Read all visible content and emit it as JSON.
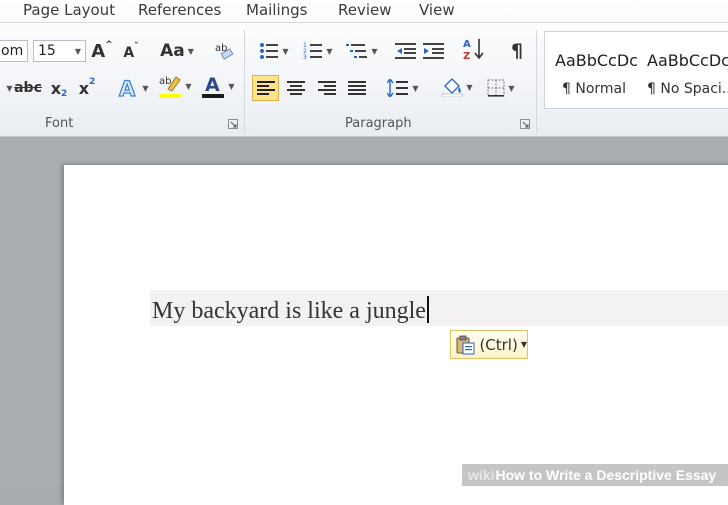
{
  "tabs": [
    "Page Layout",
    "References",
    "Mailings",
    "Review",
    "View"
  ],
  "font": {
    "name_partial": "om",
    "size": "15",
    "group_label": "Font",
    "highlight_color": "#ffff00",
    "font_color": "#1a1a1a",
    "highlight_letters": "ab",
    "change_case_label": "Aa",
    "spell_letters": "ab",
    "grow_letter": "A",
    "shrink_letter": "A",
    "sub_letter": "x",
    "sup_letter": "x",
    "sub_index": "2",
    "sup_index": "2",
    "strike_letters": "abc",
    "effects_letter": "A",
    "color_letter": "A"
  },
  "paragraph": {
    "group_label": "Paragraph",
    "pilcrow": "¶",
    "sort_a": "A",
    "sort_z": "Z"
  },
  "styles": [
    {
      "sample": "AaBbCcDc",
      "name": "¶ Normal"
    },
    {
      "sample": "AaBbCcDc",
      "name": "¶ No Spaci..."
    }
  ],
  "document": {
    "text": "My backyard is like a jungle"
  },
  "paste_options": {
    "label": "(Ctrl)"
  },
  "watermark": {
    "brand": "wiki",
    "title": "How to Write a Descriptive Essay"
  },
  "colors": {
    "accent_selected": "#fde38a",
    "ribbon_bg": "#f3f5f8",
    "page_bg": "#ffffff",
    "workspace_bg": "#a9acb1"
  },
  "icons": {
    "launcher": "dialog-launcher-icon",
    "paste": "clipboard-paste-icon"
  }
}
